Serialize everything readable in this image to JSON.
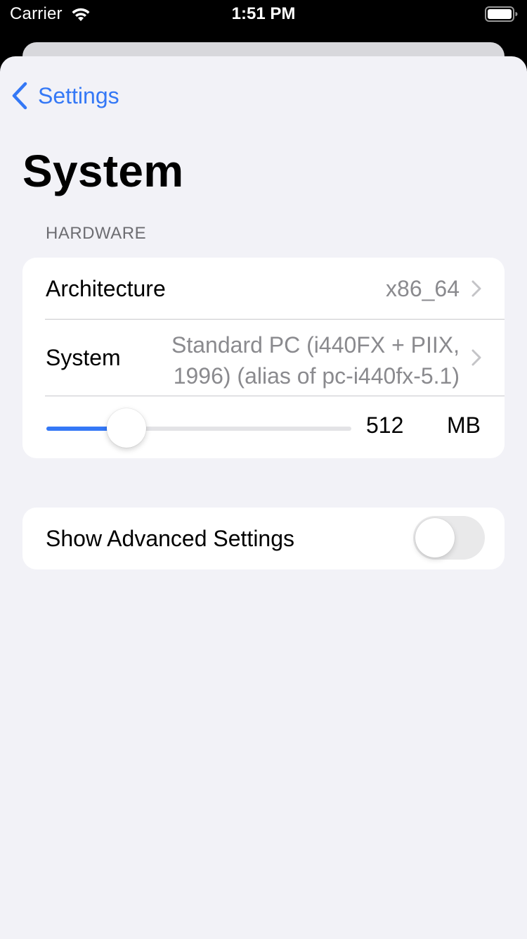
{
  "status_bar": {
    "carrier": "Carrier",
    "time": "1:51 PM",
    "wifi_icon": "wifi-icon",
    "battery_icon": "battery-icon"
  },
  "nav": {
    "back_label": "Settings",
    "back_icon": "chevron-left-icon",
    "title": "System"
  },
  "hardware": {
    "header": "HARDWARE",
    "architecture": {
      "label": "Architecture",
      "value": "x86_64"
    },
    "system": {
      "label": "System",
      "value_line1": "Standard PC (i440FX + PIIX,",
      "value_line2": "1996) (alias of pc-i440fx-5.1)"
    },
    "memory": {
      "value": "512",
      "unit": "MB",
      "slider_fraction": 0.263
    }
  },
  "advanced": {
    "label": "Show Advanced Settings",
    "enabled": false
  },
  "colors": {
    "accent": "#3478f6",
    "background": "#f2f2f7",
    "secondary_text": "#8a8a8e"
  }
}
